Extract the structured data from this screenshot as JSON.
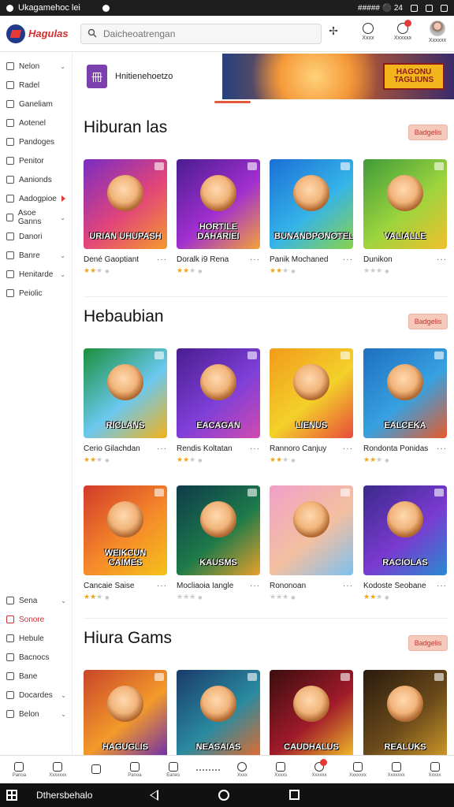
{
  "status_bar": {
    "title": "Ukagamehoc lei",
    "right_text": "##### ⚫ 24"
  },
  "header": {
    "logo_text": "Hagulas",
    "search_placeholder": "Daicheoatrengan",
    "icons": [
      {
        "name": "star-burst-icon",
        "label": ""
      },
      {
        "name": "sync-icon",
        "label": "Xxxx"
      },
      {
        "name": "notifications-icon",
        "label": "Xxxxxx"
      },
      {
        "name": "profile-icon",
        "label": "Xxxxxx"
      }
    ]
  },
  "sidebar": {
    "items": [
      {
        "label": "Nelon",
        "chevron": true
      },
      {
        "label": "Radel"
      },
      {
        "label": "Ganeliam"
      },
      {
        "label": "Aotenel"
      },
      {
        "label": "Pandoges"
      },
      {
        "label": "Penitor"
      },
      {
        "label": "Aanionds"
      },
      {
        "label": "Aadogpioe",
        "reddot": true
      },
      {
        "label": "Asoe Ganns",
        "chevron": true
      },
      {
        "label": "Danori"
      },
      {
        "label": "Banre",
        "chevron": true
      },
      {
        "label": "Henitarde",
        "chevron": true
      },
      {
        "label": "Peiolic"
      }
    ],
    "bottom_items": [
      {
        "label": "Sena",
        "chevron": true
      },
      {
        "label": "Sonore",
        "active": true
      },
      {
        "label": "Hebule"
      },
      {
        "label": "Bacnocs"
      },
      {
        "label": "Bane"
      },
      {
        "label": "Docardes",
        "chevron": true
      },
      {
        "label": "Belon",
        "chevron": true
      }
    ]
  },
  "banner": {
    "text": "Hnitienehoetzo",
    "logo_text": "HAGONU TAGLIUNS"
  },
  "sections": [
    {
      "title": "Hiburan las",
      "more_label": "Badgelis",
      "cards": [
        {
          "name": "Dené Gaoptiant",
          "thumb_text": "URIAN UHUPASH",
          "stars": 2
        },
        {
          "name": "Doralk i9 Rena",
          "thumb_text": "HORTILE DAHARIEI",
          "stars": 2
        },
        {
          "name": "Panik Mochaned",
          "thumb_text": "BUNANDPONOTEL",
          "stars": 2
        },
        {
          "name": "Dunikon",
          "thumb_text": "VALIALLE",
          "stars": 0
        }
      ]
    },
    {
      "title": "Hebaubian",
      "more_label": "Badgelis",
      "cards": [
        {
          "name": "Cerio Gilachdan",
          "thumb_text": "RICLANS",
          "stars": 2
        },
        {
          "name": "Rendis Koltatan",
          "thumb_text": "EACAGAN",
          "stars": 2
        },
        {
          "name": "Rannoro Canjuy",
          "thumb_text": "LIENUS",
          "stars": 2
        },
        {
          "name": "Rondonta Ponidas",
          "thumb_text": "EALCEKA",
          "stars": 2
        }
      ]
    },
    {
      "title": "",
      "more_label": "",
      "cards": [
        {
          "name": "Cancaie Saise",
          "thumb_text": "WEIKCUN CAIMES",
          "stars": 2
        },
        {
          "name": "Mocliaoia Iangle",
          "thumb_text": "KAUSMS",
          "stars": 0
        },
        {
          "name": "Rononoan",
          "thumb_text": "",
          "stars": 0
        },
        {
          "name": "Kodoste Seobane",
          "thumb_text": "RACIOLAS",
          "stars": 2
        }
      ]
    },
    {
      "title": "Hiura Gams",
      "more_label": "Badgelis",
      "cards": [
        {
          "name": "",
          "thumb_text": "HAGUGLIS",
          "stars": 0
        },
        {
          "name": "",
          "thumb_text": "NEASAIAS",
          "stars": 0
        },
        {
          "name": "",
          "thumb_text": "CAUDHALUS",
          "stars": 0
        },
        {
          "name": "",
          "thumb_text": "REALUKS",
          "stars": 0
        }
      ]
    }
  ],
  "bottom_nav": [
    {
      "name": "home-icon",
      "label": "Panoa"
    },
    {
      "name": "chat-icon",
      "label": "Xxxxxxx"
    },
    {
      "name": "window-icon",
      "label": ""
    },
    {
      "name": "edit-icon",
      "label": "Panoa"
    },
    {
      "name": "doc-icon",
      "label": "Eanes"
    },
    {
      "name": "clock-icon",
      "label": "Xxxx"
    },
    {
      "name": "spark-icon",
      "label": "Xxxxs"
    },
    {
      "name": "alert-icon",
      "label": "Xxxxxx"
    },
    {
      "name": "library-icon",
      "label": "Xxxxxxx"
    },
    {
      "name": "list-icon",
      "label": "Xxxxxxx"
    },
    {
      "name": "user-icon",
      "label": "Xxxxx"
    }
  ],
  "system_nav": {
    "label": "Dthersbehalo"
  }
}
